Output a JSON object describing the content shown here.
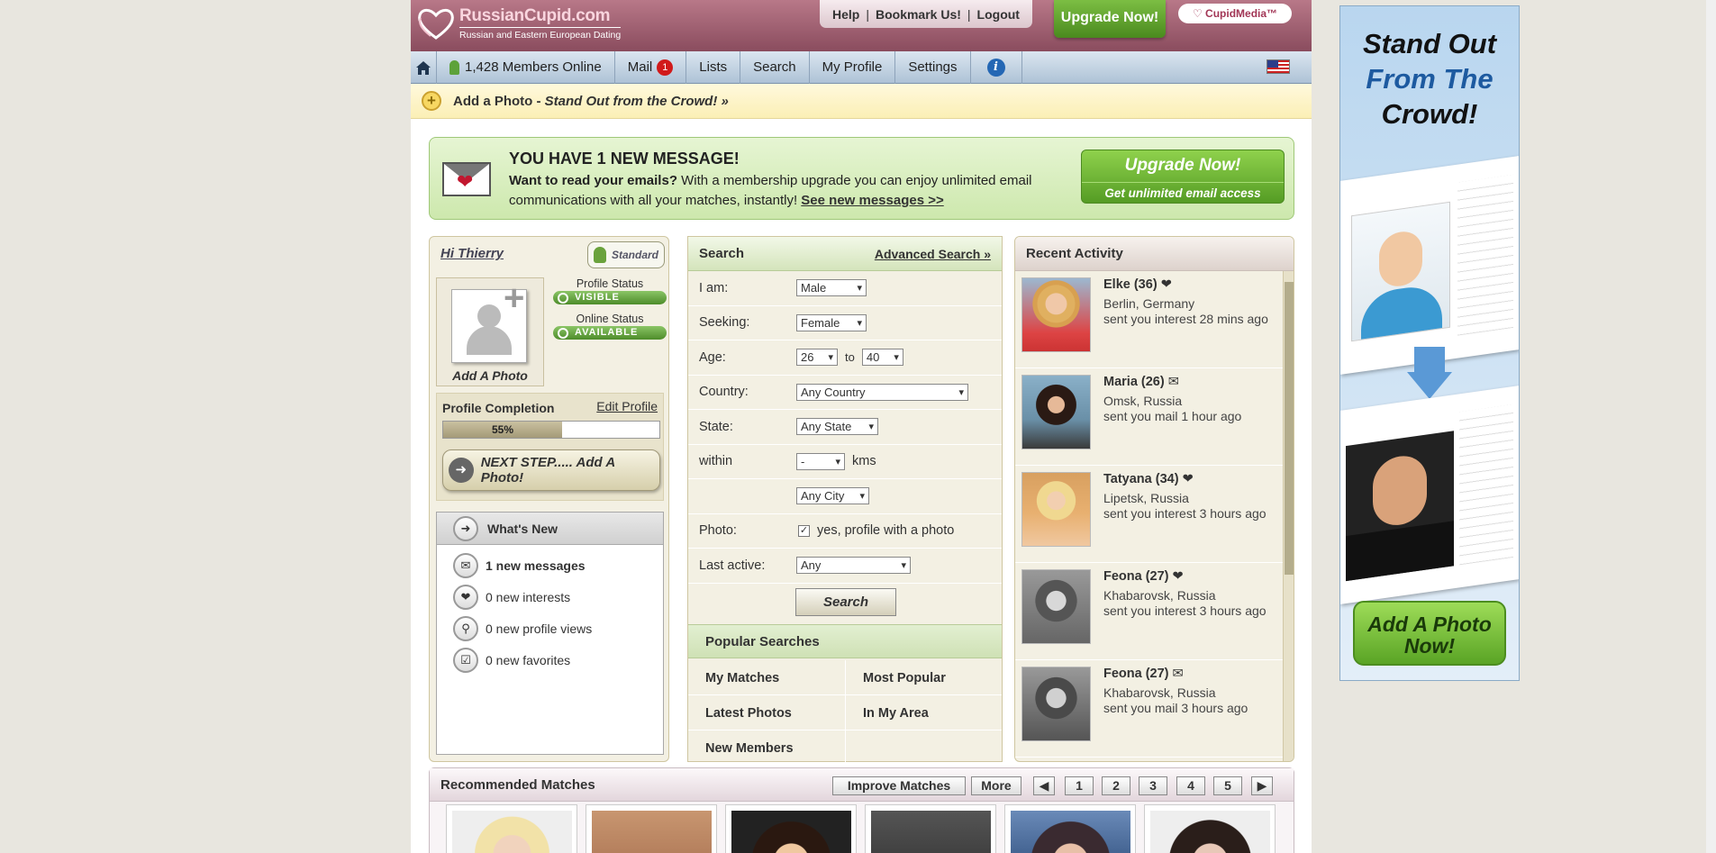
{
  "header": {
    "logo_name": "RussianCupid.com",
    "logo_tag": "Russian and Eastern European Dating",
    "links": [
      "Help",
      "Bookmark Us!",
      "Logout"
    ],
    "upgrade": "Upgrade Now!",
    "partner": "CupidMedia™"
  },
  "nav": {
    "members_online": "1,428 Members Online",
    "mail": "Mail",
    "mail_count": "1",
    "lists": "Lists",
    "search": "Search",
    "my_profile": "My Profile",
    "settings": "Settings",
    "info": "i"
  },
  "add_photo_strip": {
    "lead": "Add a Photo - ",
    "tag": "Stand Out from the Crowd! »"
  },
  "message": {
    "title": "YOU HAVE 1 NEW MESSAGE!",
    "question": "Want to read your emails?",
    "body": " With a membership upgrade you can enjoy unlimited email communications with all your matches, instantly! ",
    "link": "See new messages >>",
    "btn_main": "Upgrade Now!",
    "btn_sub": "Get unlimited email access"
  },
  "profile": {
    "greeting": "Hi Thierry",
    "membership": "Standard",
    "add_photo": "Add A Photo",
    "profile_status_label": "Profile Status",
    "profile_status": "VISIBLE",
    "online_status_label": "Online Status",
    "online_status": "AVAILABLE",
    "completion_label": "Profile Completion",
    "edit_profile": "Edit Profile",
    "completion_pct": 55,
    "completion_text": "55%",
    "next_step": "NEXT STEP..... Add A Photo!"
  },
  "whats_new": {
    "title": "What's New",
    "items": [
      "1 new messages",
      "0 new interests",
      "0 new profile views",
      "0 new favorites"
    ]
  },
  "search": {
    "title": "Search",
    "advanced": "Advanced Search »",
    "i_am_label": "I am:",
    "i_am": "Male",
    "seeking_label": "Seeking:",
    "seeking": "Female",
    "age_label": "Age:",
    "age_from": "26",
    "age_to_label": "to",
    "age_to": "40",
    "country_label": "Country:",
    "country": "Any Country",
    "state_label": "State:",
    "state": "Any State",
    "within_label": "within",
    "within": "-",
    "within_unit": "kms",
    "city": "Any City",
    "photo_label": "Photo:",
    "photo_text": "yes, profile with a photo",
    "last_active_label": "Last active:",
    "last_active": "Any",
    "button": "Search"
  },
  "popular": {
    "title": "Popular Searches",
    "items": [
      "My Matches",
      "Most Popular",
      "Latest Photos",
      "In My Area",
      "New Members"
    ]
  },
  "recent": {
    "title": "Recent Activity",
    "items": [
      {
        "name": "Elke (36)",
        "icon": "heart-icon",
        "place": "Berlin, Germany",
        "action": "sent you interest 28 mins ago"
      },
      {
        "name": "Maria (26)",
        "icon": "envelope-icon",
        "place": "Omsk, Russia",
        "action": "sent you mail 1 hour ago"
      },
      {
        "name": "Tatyana (34)",
        "icon": "heart-icon",
        "place": "Lipetsk, Russia",
        "action": "sent you interest 3 hours ago"
      },
      {
        "name": "Feona (27)",
        "icon": "heart-icon",
        "place": "Khabarovsk, Russia",
        "action": "sent you interest 3 hours ago"
      },
      {
        "name": "Feona (27)",
        "icon": "envelope-icon",
        "place": "Khabarovsk, Russia",
        "action": "sent you mail 3 hours ago"
      }
    ]
  },
  "recommended": {
    "title": "Recommended Matches",
    "improve": "Improve Matches",
    "more": "More",
    "pages": [
      "1",
      "2",
      "3",
      "4",
      "5"
    ]
  },
  "ad": {
    "line1": "Stand Out",
    "line2": "From The",
    "line3": "Crowd!",
    "button": "Add A Photo Now!"
  }
}
